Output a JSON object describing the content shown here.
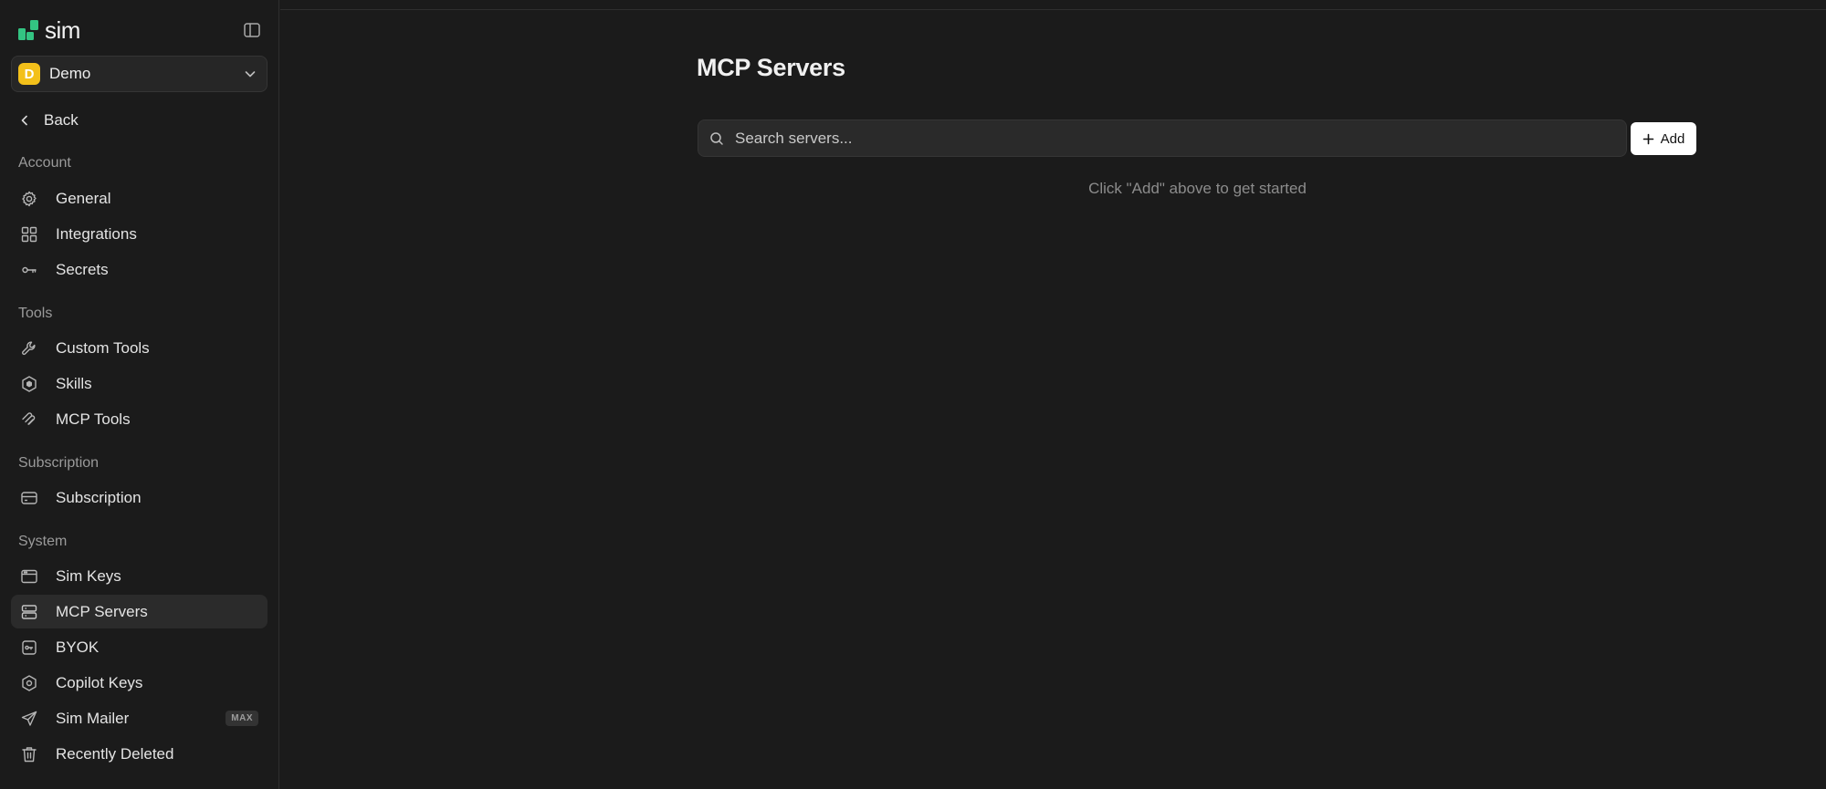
{
  "brand": {
    "name": "sim",
    "logo_color": "#33c482"
  },
  "workspace": {
    "initial": "D",
    "name": "Demo",
    "avatar_color": "#f3c01a"
  },
  "nav": {
    "back_label": "Back",
    "sections": {
      "account": "Account",
      "tools": "Tools",
      "subscription": "Subscription",
      "system": "System"
    },
    "items": {
      "general": "General",
      "integrations": "Integrations",
      "secrets": "Secrets",
      "custom_tools": "Custom Tools",
      "skills": "Skills",
      "mcp_tools": "MCP Tools",
      "subscription": "Subscription",
      "sim_keys": "Sim Keys",
      "mcp_servers": "MCP Servers",
      "byok": "BYOK",
      "copilot_keys": "Copilot Keys",
      "sim_mailer": "Sim Mailer",
      "recently_deleted": "Recently Deleted"
    },
    "sim_mailer_badge": "MAX",
    "active_item": "MCP Servers"
  },
  "main": {
    "title": "MCP Servers",
    "search_placeholder": "Search servers...",
    "add_label": "Add",
    "empty_hint": "Click \"Add\" above to get started"
  }
}
